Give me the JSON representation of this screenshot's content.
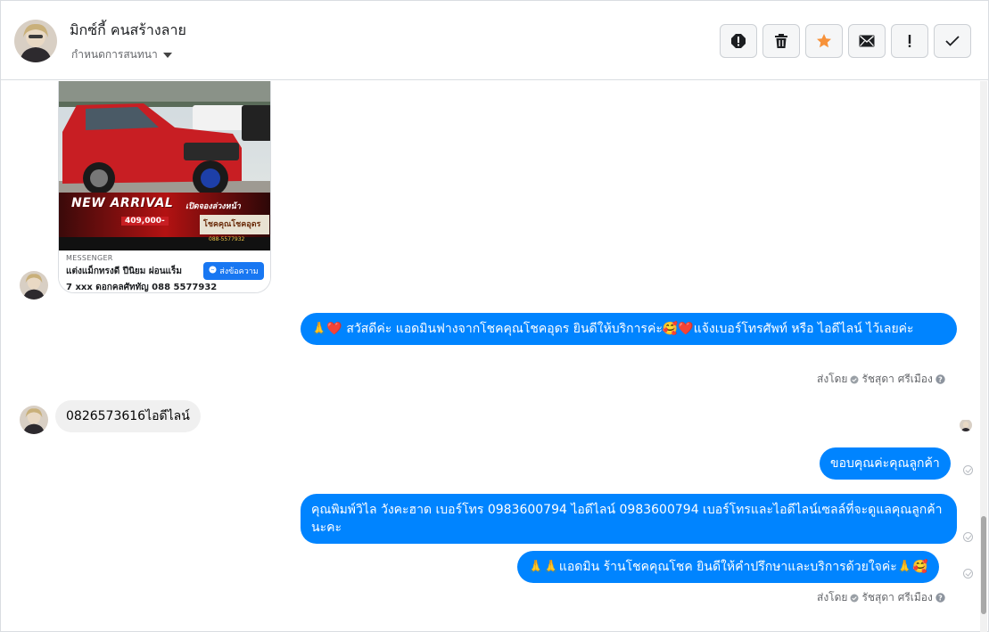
{
  "header": {
    "contact_name": "มิกซ์กี้ คนสร้างลาย",
    "sub_label": "กำหนดการสนทนา",
    "toolbar": [
      {
        "name": "report-icon"
      },
      {
        "name": "trash-icon"
      },
      {
        "name": "star-icon"
      },
      {
        "name": "mail-icon"
      },
      {
        "name": "exclamation-icon"
      },
      {
        "name": "check-icon"
      }
    ]
  },
  "card": {
    "badge_new": "NEW ARRIVAL",
    "badge_sub": "เปิดจองล่วงหน้า",
    "price": "409,000-",
    "shop": "โชคคุณโชคอุดร",
    "phone_small": "088-5577932",
    "source": "MESSENGER",
    "title": "แต่งแม็กทรงดี ปีนิยม ผ่อนแร็ม",
    "line2": "7 xxx ดอกคลศัททัญ 088 5577932",
    "button": "ส่งข้อความ"
  },
  "messages": [
    {
      "id": "m1",
      "text": "🙏❤️ สวัสดีค่ะ แอดมินฟางจากโชคคุณโชคอุดร ยินดีให้บริการค่ะ🥰❤️แจ้งเบอร์โทรศัพท์ หรือ ไอดีไลน์  ไว้เลยค่ะ"
    },
    {
      "id": "m2",
      "text": "0826573616ไอดีไลน์"
    },
    {
      "id": "m3",
      "text": "ขอบคุณค่ะคุณลูกค้า"
    },
    {
      "id": "m4",
      "text": "คุณพิมพ์วิไล วังคะฮาด   เบอร์โทร 0983600794  ไอดีไลน์ 0983600794   เบอร์โทรและไอดีไลน์เซลล์ที่จะดูแลคุณลูกค้านะคะ"
    },
    {
      "id": "m5",
      "text": "🙏🙏แอดมิน ร้านโชคคุณโชค ยินดีให้คำปรึกษาและบริการด้วยใจค่ะ🙏🥰"
    }
  ],
  "sent_by": {
    "prefix": "ส่งโดย",
    "name": "รัชสุดา ศรีเมือง"
  },
  "colors": {
    "outgoing": "#0084ff",
    "incoming": "#f0f0f0",
    "star": "#f7923a"
  }
}
